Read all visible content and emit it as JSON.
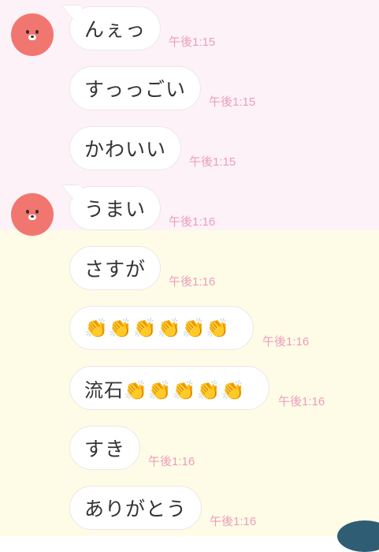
{
  "messages": [
    {
      "text": "んぇっ",
      "time": "午後1:15",
      "avatar": true
    },
    {
      "text": "すっっごい",
      "time": "午後1:15",
      "avatar": false
    },
    {
      "text": "かわいい",
      "time": "午後1:15",
      "avatar": false
    },
    {
      "text": "うまい",
      "time": "午後1:16",
      "avatar": true
    },
    {
      "text": "さすが",
      "time": "午後1:16",
      "avatar": false
    },
    {
      "text": "👏👏👏👏👏👏",
      "time": "午後1:16",
      "avatar": false
    },
    {
      "text": "流石👏👏👏👏👏",
      "time": "午後1:16",
      "avatar": false
    },
    {
      "text": "すき",
      "time": "午後1:16",
      "avatar": false
    },
    {
      "text": "ありがとう",
      "time": "午後1:16",
      "avatar": false
    }
  ],
  "colors": {
    "background_pink": "#fdf2f7",
    "background_yellow": "#fefce6",
    "avatar": "#f27670",
    "timestamp": "#ec9dbd"
  },
  "icons": {
    "avatar": "bear-face-avatar-icon",
    "corner": "partial-avatar-icon"
  }
}
